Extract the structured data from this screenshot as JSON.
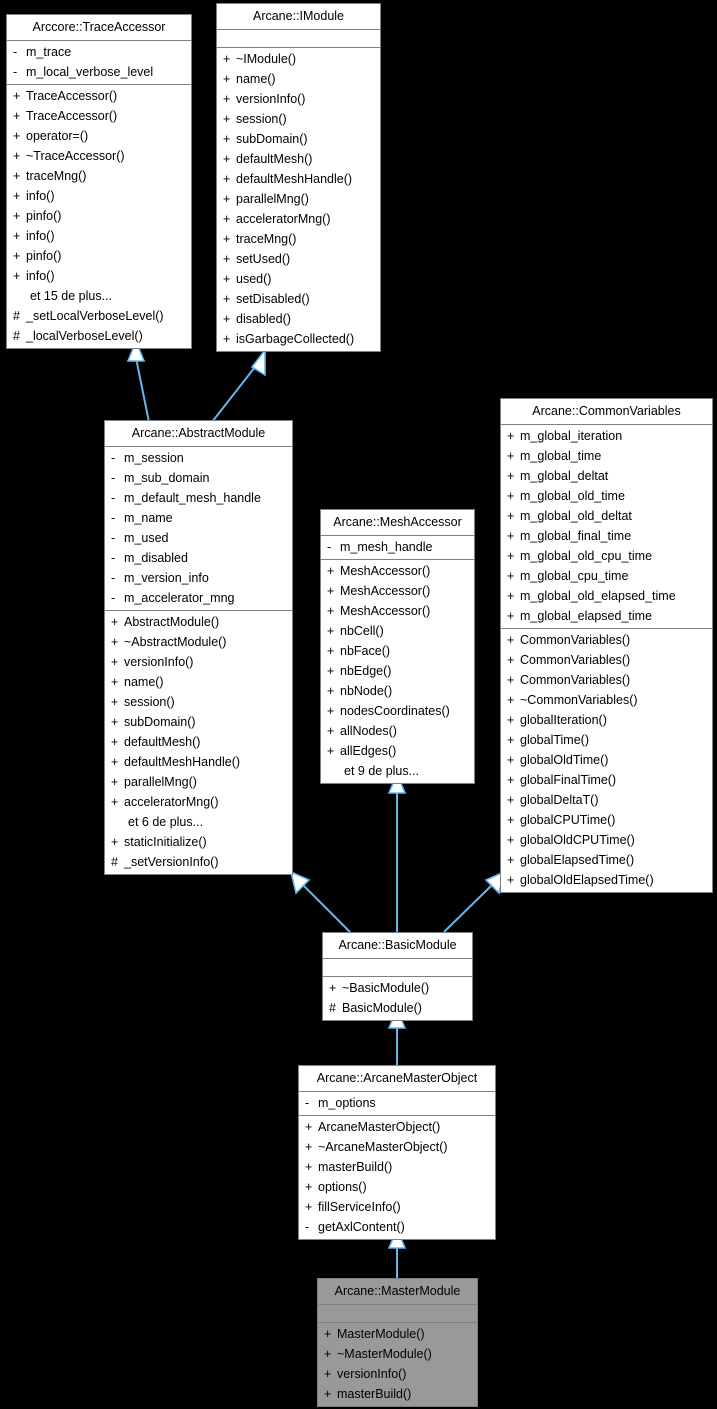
{
  "diagram": {
    "title": "Arcane::MasterModule inheritance diagram",
    "background": "#000000",
    "edge_color": "#63b8ee",
    "node_border_color": "#808080",
    "node_background": "#ffffff",
    "highlight_background": "#999999",
    "more_label_trace": "et 15 de plus...",
    "more_label_abstract": "et 6 de plus...",
    "more_label_mesh": "et 9 de plus..."
  },
  "nodes": [
    {
      "id": "trace_accessor",
      "title": "Arccore::TraceAccessor",
      "attributes": [
        {
          "vis": "-",
          "name": "m_trace"
        },
        {
          "vis": "-",
          "name": "m_local_verbose_level"
        }
      ],
      "methods": [
        {
          "vis": "+",
          "name": "TraceAccessor()"
        },
        {
          "vis": "+",
          "name": "TraceAccessor()"
        },
        {
          "vis": "+",
          "name": "operator=()"
        },
        {
          "vis": "+",
          "name": "~TraceAccessor()"
        },
        {
          "vis": "+",
          "name": "traceMng()"
        },
        {
          "vis": "+",
          "name": "info()"
        },
        {
          "vis": "+",
          "name": "pinfo()"
        },
        {
          "vis": "+",
          "name": "info()"
        },
        {
          "vis": "+",
          "name": "pinfo()"
        },
        {
          "vis": "+",
          "name": "info()"
        },
        {
          "vis": "",
          "name": "et 15 de plus...",
          "more": true
        },
        {
          "vis": "#",
          "name": "_setLocalVerboseLevel()"
        },
        {
          "vis": "#",
          "name": "_localVerboseLevel()"
        }
      ]
    },
    {
      "id": "imodule",
      "title": "Arcane::IModule",
      "attributes": [],
      "methods": [
        {
          "vis": "+",
          "name": "~IModule()"
        },
        {
          "vis": "+",
          "name": "name()"
        },
        {
          "vis": "+",
          "name": "versionInfo()"
        },
        {
          "vis": "+",
          "name": "session()"
        },
        {
          "vis": "+",
          "name": "subDomain()"
        },
        {
          "vis": "+",
          "name": "defaultMesh()"
        },
        {
          "vis": "+",
          "name": "defaultMeshHandle()"
        },
        {
          "vis": "+",
          "name": "parallelMng()"
        },
        {
          "vis": "+",
          "name": "acceleratorMng()"
        },
        {
          "vis": "+",
          "name": "traceMng()"
        },
        {
          "vis": "+",
          "name": "setUsed()"
        },
        {
          "vis": "+",
          "name": "used()"
        },
        {
          "vis": "+",
          "name": "setDisabled()"
        },
        {
          "vis": "+",
          "name": "disabled()"
        },
        {
          "vis": "+",
          "name": "isGarbageCollected()"
        }
      ]
    },
    {
      "id": "abstract_module",
      "title": "Arcane::AbstractModule",
      "attributes": [
        {
          "vis": "-",
          "name": "m_session"
        },
        {
          "vis": "-",
          "name": "m_sub_domain"
        },
        {
          "vis": "-",
          "name": "m_default_mesh_handle"
        },
        {
          "vis": "-",
          "name": "m_name"
        },
        {
          "vis": "-",
          "name": "m_used"
        },
        {
          "vis": "-",
          "name": "m_disabled"
        },
        {
          "vis": "-",
          "name": "m_version_info"
        },
        {
          "vis": "-",
          "name": "m_accelerator_mng"
        }
      ],
      "methods": [
        {
          "vis": "+",
          "name": "AbstractModule()"
        },
        {
          "vis": "+",
          "name": "~AbstractModule()"
        },
        {
          "vis": "+",
          "name": "versionInfo()"
        },
        {
          "vis": "+",
          "name": "name()"
        },
        {
          "vis": "+",
          "name": "session()"
        },
        {
          "vis": "+",
          "name": "subDomain()"
        },
        {
          "vis": "+",
          "name": "defaultMesh()"
        },
        {
          "vis": "+",
          "name": "defaultMeshHandle()"
        },
        {
          "vis": "+",
          "name": "parallelMng()"
        },
        {
          "vis": "+",
          "name": "acceleratorMng()"
        },
        {
          "vis": "",
          "name": "et 6 de plus...",
          "more": true
        },
        {
          "vis": "+",
          "name": "staticInitialize()"
        },
        {
          "vis": "#",
          "name": "_setVersionInfo()"
        }
      ]
    },
    {
      "id": "mesh_accessor",
      "title": "Arcane::MeshAccessor",
      "attributes": [
        {
          "vis": "-",
          "name": "m_mesh_handle"
        }
      ],
      "methods": [
        {
          "vis": "+",
          "name": "MeshAccessor()"
        },
        {
          "vis": "+",
          "name": "MeshAccessor()"
        },
        {
          "vis": "+",
          "name": "MeshAccessor()"
        },
        {
          "vis": "+",
          "name": "nbCell()"
        },
        {
          "vis": "+",
          "name": "nbFace()"
        },
        {
          "vis": "+",
          "name": "nbEdge()"
        },
        {
          "vis": "+",
          "name": "nbNode()"
        },
        {
          "vis": "+",
          "name": "nodesCoordinates()"
        },
        {
          "vis": "+",
          "name": "allNodes()"
        },
        {
          "vis": "+",
          "name": "allEdges()"
        },
        {
          "vis": "",
          "name": "et 9 de plus...",
          "more": true
        }
      ]
    },
    {
      "id": "common_variables",
      "title": "Arcane::CommonVariables",
      "attributes": [
        {
          "vis": "+",
          "name": "m_global_iteration"
        },
        {
          "vis": "+",
          "name": "m_global_time"
        },
        {
          "vis": "+",
          "name": "m_global_deltat"
        },
        {
          "vis": "+",
          "name": "m_global_old_time"
        },
        {
          "vis": "+",
          "name": "m_global_old_deltat"
        },
        {
          "vis": "+",
          "name": "m_global_final_time"
        },
        {
          "vis": "+",
          "name": "m_global_old_cpu_time"
        },
        {
          "vis": "+",
          "name": "m_global_cpu_time"
        },
        {
          "vis": "+",
          "name": "m_global_old_elapsed_time"
        },
        {
          "vis": "+",
          "name": "m_global_elapsed_time"
        }
      ],
      "methods": [
        {
          "vis": "+",
          "name": "CommonVariables()"
        },
        {
          "vis": "+",
          "name": "CommonVariables()"
        },
        {
          "vis": "+",
          "name": "CommonVariables()"
        },
        {
          "vis": "+",
          "name": "~CommonVariables()"
        },
        {
          "vis": "+",
          "name": "globalIteration()"
        },
        {
          "vis": "+",
          "name": "globalTime()"
        },
        {
          "vis": "+",
          "name": "globalOldTime()"
        },
        {
          "vis": "+",
          "name": "globalFinalTime()"
        },
        {
          "vis": "+",
          "name": "globalDeltaT()"
        },
        {
          "vis": "+",
          "name": "globalCPUTime()"
        },
        {
          "vis": "+",
          "name": "globalOldCPUTime()"
        },
        {
          "vis": "+",
          "name": "globalElapsedTime()"
        },
        {
          "vis": "+",
          "name": "globalOldElapsedTime()"
        }
      ]
    },
    {
      "id": "basic_module",
      "title": "Arcane::BasicModule",
      "attributes": [],
      "methods": [
        {
          "vis": "+",
          "name": "~BasicModule()"
        },
        {
          "vis": "#",
          "name": "BasicModule()"
        }
      ]
    },
    {
      "id": "arcane_master_object",
      "title": "Arcane::ArcaneMasterObject",
      "attributes": [
        {
          "vis": "-",
          "name": "m_options"
        }
      ],
      "methods": [
        {
          "vis": "+",
          "name": "ArcaneMasterObject()"
        },
        {
          "vis": "+",
          "name": "~ArcaneMasterObject()"
        },
        {
          "vis": "+",
          "name": "masterBuild()"
        },
        {
          "vis": "+",
          "name": "options()"
        },
        {
          "vis": "+",
          "name": "fillServiceInfo()"
        },
        {
          "vis": "-",
          "name": "getAxlContent()"
        }
      ]
    },
    {
      "id": "master_module",
      "title": "Arcane::MasterModule",
      "highlight": true,
      "attributes": [],
      "methods": [
        {
          "vis": "+",
          "name": "MasterModule()"
        },
        {
          "vis": "+",
          "name": "~MasterModule()"
        },
        {
          "vis": "+",
          "name": "versionInfo()"
        },
        {
          "vis": "+",
          "name": "masterBuild()"
        }
      ]
    }
  ],
  "edges": [
    {
      "from": "abstract_module",
      "to": "trace_accessor",
      "kind": "inheritance"
    },
    {
      "from": "abstract_module",
      "to": "imodule",
      "kind": "inheritance"
    },
    {
      "from": "basic_module",
      "to": "abstract_module",
      "kind": "inheritance"
    },
    {
      "from": "basic_module",
      "to": "mesh_accessor",
      "kind": "inheritance"
    },
    {
      "from": "basic_module",
      "to": "common_variables",
      "kind": "inheritance"
    },
    {
      "from": "arcane_master_object",
      "to": "basic_module",
      "kind": "inheritance"
    },
    {
      "from": "master_module",
      "to": "arcane_master_object",
      "kind": "inheritance"
    }
  ]
}
